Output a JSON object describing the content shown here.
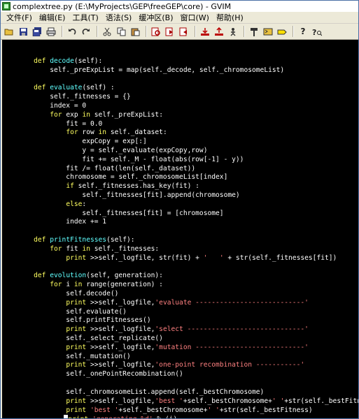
{
  "window": {
    "title": "complextree.py (E:\\MyProjects\\GEP\\freeGEP\\core) - GVIM"
  },
  "menubar": {
    "items": [
      "文件(F)",
      "编辑(E)",
      "工具(T)",
      "语法(S)",
      "缓冲区(B)",
      "窗口(W)",
      "帮助(H)"
    ]
  },
  "toolbar": {
    "buttons": [
      {
        "name": "open-icon"
      },
      {
        "name": "save-icon"
      },
      {
        "name": "save-all-icon"
      },
      {
        "name": "print-icon"
      },
      {
        "name": "undo-icon"
      },
      {
        "name": "redo-icon"
      },
      {
        "name": "cut-icon"
      },
      {
        "name": "copy-icon"
      },
      {
        "name": "paste-icon"
      },
      {
        "name": "find-icon"
      },
      {
        "name": "find-next-icon"
      },
      {
        "name": "find-prev-icon"
      },
      {
        "name": "load-session-icon"
      },
      {
        "name": "save-session-icon"
      },
      {
        "name": "run-script-icon"
      },
      {
        "name": "make-icon"
      },
      {
        "name": "shell-icon"
      },
      {
        "name": "tags-icon"
      },
      {
        "name": "help-icon"
      },
      {
        "name": "find-help-icon"
      }
    ]
  },
  "editor": {
    "lines": [
      "",
      "    def decode(self):",
      "        self._preExpList = map(self._decode, self._chromosomeList)",
      "",
      "    def evaluate(self) :",
      "        self._fitnesses = {}",
      "        index = 0",
      "        for exp in self._preExpList:",
      "            fit = 0.0",
      "            for row in self._dataset:",
      "                expCopy = exp[:]",
      "                y = self._evaluate(expCopy,row)",
      "                fit += self._M - float(abs(row[-1] - y))",
      "            fit /= float(len(self._dataset))",
      "            chromosome = self._chromosomeList[index]",
      "            if self._fitnesses.has_key(fit) :",
      "                self._fitnesses[fit].append(chromosome)",
      "            else:",
      "                self._fitnesses[fit] = [chromosome]",
      "            index += 1",
      "",
      "    def printFitnesses(self):",
      "        for fit in self._fitnesses:",
      "            print >>self._logfile, str(fit) + '   ' + str(self._fitnesses[fit])",
      "",
      "    def evolution(self, generation):",
      "        for i in range(generation) :",
      "            self.decode()",
      "            print >>self._logfile,'evaluate ---------------------------'",
      "            self.evaluate()",
      "            self.printFitnesses()",
      "            print >>self._logfile,'select -----------------------------'",
      "            self._select_replicate()",
      "            print >>self._logfile,'mutation ---------------------------'",
      "            self._mutation()",
      "            print >>self._logfile,'one-point recombination -----------'",
      "            self._onePointRecombination()",
      "",
      "            self._chromosomeList.append(self._bestChromosome)",
      "            print >>self._logfile,'best '+self._bestChromosome+' '+str(self._bestFitness)",
      "            print 'best '+self._bestChromosome+' '+str(self._bestFitness)",
      "            print 'generating %d' % (i)"
    ]
  },
  "colors": {
    "background": "#000000",
    "text": "#ffffff",
    "keyword": "#ffff60",
    "function": "#60ffff",
    "string": "#ff8080"
  }
}
